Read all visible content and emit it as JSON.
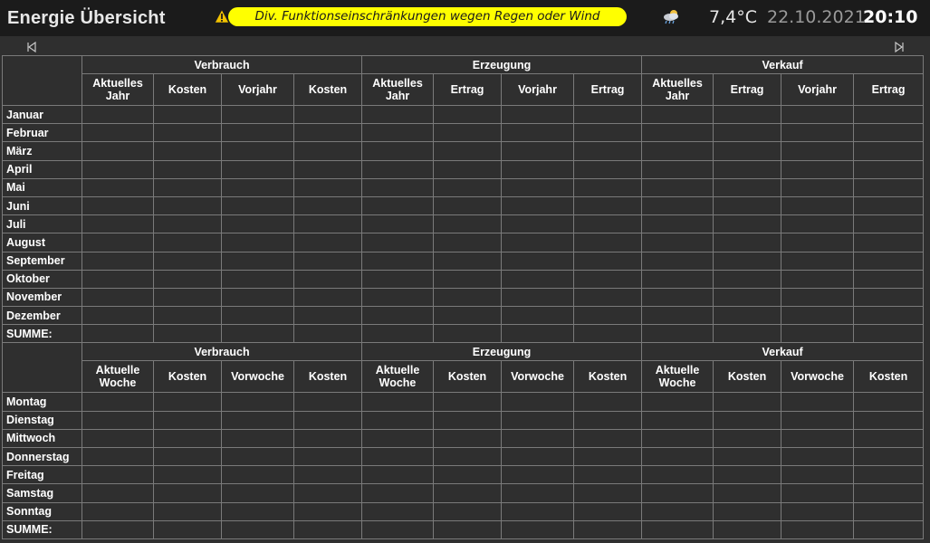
{
  "header": {
    "title": "Energie Übersicht",
    "warning": "Div. Funktionseinschränkungen wegen Regen oder Wind",
    "temperature": "7,4°C",
    "date": "22.10.2021",
    "time": "20:10",
    "warning_color": "#ffff00",
    "warning_icon": "warning-icon",
    "weather_icon": "cloudy-rain-icon"
  },
  "navigation": {
    "prev_icon": "arrow-left-icon",
    "next_icon": "arrow-right-icon"
  },
  "monthly": {
    "groups": [
      "Verbrauch",
      "Erzeugung",
      "Verkauf"
    ],
    "subheaders": [
      [
        "Aktuelles Jahr",
        "Kosten",
        "Vorjahr",
        "Kosten"
      ],
      [
        "Aktuelles Jahr",
        "Ertrag",
        "Vorjahr",
        "Ertrag"
      ],
      [
        "Aktuelles Jahr",
        "Ertrag",
        "Vorjahr",
        "Ertrag"
      ]
    ],
    "rows": [
      "Januar",
      "Februar",
      "März",
      "April",
      "Mai",
      "Juni",
      "Juli",
      "August",
      "September",
      "Oktober",
      "November",
      "Dezember",
      "SUMME:"
    ]
  },
  "weekly": {
    "groups": [
      "Verbrauch",
      "Erzeugung",
      "Verkauf"
    ],
    "subheaders": [
      [
        "Aktuelle Woche",
        "Kosten",
        "Vorwoche",
        "Kosten"
      ],
      [
        "Aktuelle Woche",
        "Kosten",
        "Vorwoche",
        "Kosten"
      ],
      [
        "Aktuelle Woche",
        "Kosten",
        "Vorwoche",
        "Kosten"
      ]
    ],
    "rows": [
      "Montag",
      "Dienstag",
      "Mittwoch",
      "Donnerstag",
      "Freitag",
      "Samstag",
      "Sonntag",
      "SUMME:"
    ]
  }
}
